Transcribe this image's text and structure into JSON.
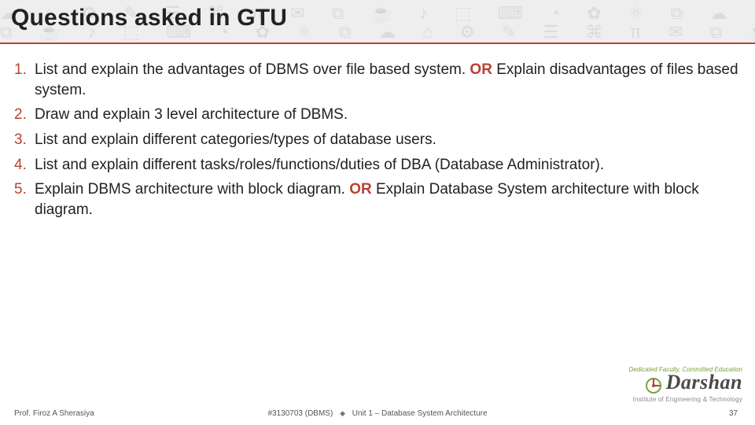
{
  "header": {
    "title": "Questions asked in  GTU"
  },
  "questions": [
    {
      "pre": "List and explain the advantages of DBMS over file based system. ",
      "or": "OR",
      "post": " Explain disadvantages of files based system."
    },
    {
      "pre": "Draw and explain 3 level architecture of DBMS.",
      "or": "",
      "post": ""
    },
    {
      "pre": "List and explain different categories/types of database users.",
      "or": "",
      "post": ""
    },
    {
      "pre": "List and explain different tasks/roles/functions/duties of DBA (Database Administrator).",
      "or": "",
      "post": ""
    },
    {
      "pre": "Explain DBMS architecture with block diagram. ",
      "or": "OR",
      "post": " Explain Database System architecture with block diagram."
    }
  ],
  "footer": {
    "professor": "Prof. Firoz A Sherasiya",
    "course_code": "#3130703 (DBMS)",
    "unit": "Unit 1 – Database System Architecture",
    "page": "37"
  },
  "logo": {
    "top_line": "Dedicated Faculty, Committed Education",
    "name": "Darshan",
    "sub": "Institute of Engineering & Technology"
  }
}
